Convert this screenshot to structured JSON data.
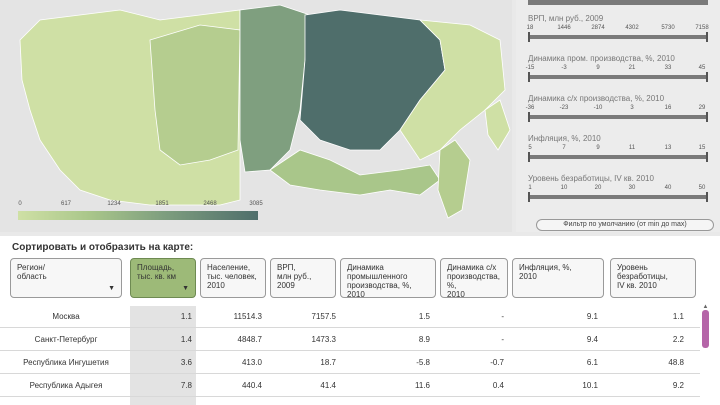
{
  "map": {
    "legend_ticks": [
      "0",
      "617",
      "1234",
      "1851",
      "2468",
      "3085"
    ],
    "colors": {
      "light": "#cfe0a5",
      "mid": "#a9c68a",
      "dark": "#7f9f7f",
      "darkest": "#4f6e6b",
      "accent": "#9dba78"
    }
  },
  "filters": [
    {
      "label": "ВРП, млн руб., 2009",
      "ticks": [
        "18",
        "1446",
        "2874",
        "4302",
        "5730",
        "7158"
      ]
    },
    {
      "label": "Динамика пром. производства, %, 2010",
      "ticks": [
        "-15",
        "-3",
        "9",
        "21",
        "33",
        "45"
      ]
    },
    {
      "label": "Динамика с/х производства, %, 2010",
      "ticks": [
        "-36",
        "-23",
        "-10",
        "3",
        "16",
        "29"
      ]
    },
    {
      "label": "Инфляция, %, 2010",
      "ticks": [
        "5",
        "7",
        "9",
        "11",
        "13",
        "15"
      ]
    },
    {
      "label": "Уровень безработицы, IV кв. 2010",
      "ticks": [
        "1",
        "10",
        "20",
        "30",
        "40",
        "50"
      ]
    }
  ],
  "reset_label": "Фильтр по умолчанию (от min до max)",
  "sort": {
    "title": "Сортировать и отобразить на карте:",
    "headers": [
      {
        "label": "Регион/\nобласть",
        "active": false
      },
      {
        "label": "Площадь,\nтыс. кв. км",
        "active": true
      },
      {
        "label": "Население,\nтыс. человек,\n2010",
        "active": false
      },
      {
        "label": "ВРП,\nмлн руб.,\n2009",
        "active": false
      },
      {
        "label": "Динамика\nпромышленного\nпроизводства, %,\n2010",
        "active": false
      },
      {
        "label": "Динамика с/х\nпроизводства, %,\n2010",
        "active": false
      },
      {
        "label": "Инфляция, %,\n2010",
        "active": false
      },
      {
        "label": "Уровень\nбезработицы,\nIV кв. 2010",
        "active": false
      }
    ],
    "arrow": "▼"
  },
  "rows": [
    {
      "name": "Москва",
      "area": "1.1",
      "pop": "11514.3",
      "gdp": "7157.5",
      "ind": "1.5",
      "agr": "-",
      "inf": "9.1",
      "unem": "1.1"
    },
    {
      "name": "Санкт-Петербург",
      "area": "1.4",
      "pop": "4848.7",
      "gdp": "1473.3",
      "ind": "8.9",
      "agr": "-",
      "inf": "9.4",
      "unem": "2.2"
    },
    {
      "name": "Республика Ингушетия",
      "area": "3.6",
      "pop": "413.0",
      "gdp": "18.7",
      "ind": "-5.8",
      "agr": "-0.7",
      "inf": "6.1",
      "unem": "48.8"
    },
    {
      "name": "Республика Адыгея",
      "area": "7.8",
      "pop": "440.4",
      "gdp": "41.4",
      "ind": "11.6",
      "agr": "0.4",
      "inf": "10.1",
      "unem": "9.2"
    }
  ]
}
